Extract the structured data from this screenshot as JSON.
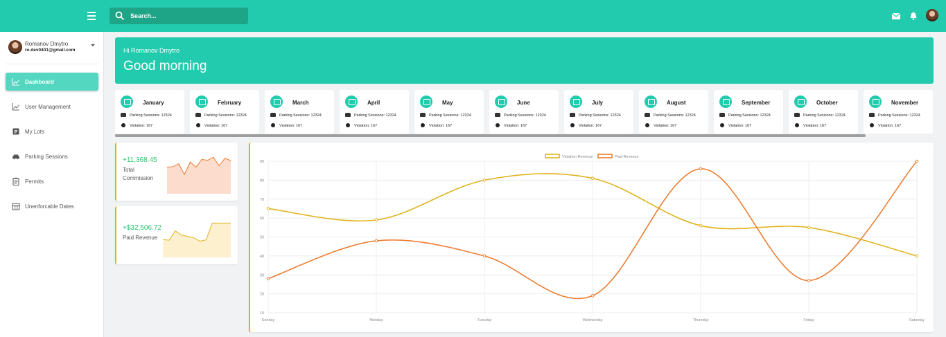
{
  "header": {
    "search_placeholder": "Search...",
    "icons": [
      "menu-icon",
      "search-icon",
      "mail-icon",
      "bell-icon",
      "user-avatar"
    ]
  },
  "user": {
    "name": "Romanov Dmytro",
    "email": "ro.dev0401@gmail.com"
  },
  "sidebar": {
    "items": [
      {
        "label": "Dashboard",
        "icon": "chart-line-icon",
        "active": true
      },
      {
        "label": "User Management",
        "icon": "chart-line-icon",
        "active": false
      },
      {
        "label": "My Lots",
        "icon": "parking-icon",
        "active": false
      },
      {
        "label": "Parking Sessions",
        "icon": "car-icon",
        "active": false
      },
      {
        "label": "Permits",
        "icon": "clipboard-icon",
        "active": false
      },
      {
        "label": "Unenforcable Dates",
        "icon": "calendar-icon",
        "active": false
      }
    ]
  },
  "greeting": {
    "hello": "Hi Romanov Dmytro",
    "message": "Good morning"
  },
  "months": [
    {
      "name": "January",
      "sessions": "Parking Sessions: 12324",
      "violations": "Violation: 167"
    },
    {
      "name": "February",
      "sessions": "Parking Sessions: 12324",
      "violations": "Violation: 167"
    },
    {
      "name": "March",
      "sessions": "Parking Sessions: 12324",
      "violations": "Violation: 167"
    },
    {
      "name": "April",
      "sessions": "Parking Sessions: 12324",
      "violations": "Violation: 167"
    },
    {
      "name": "May",
      "sessions": "Parking Sessions: 12324",
      "violations": "Violation: 167"
    },
    {
      "name": "June",
      "sessions": "Parking Sessions: 12324",
      "violations": "Violation: 167"
    },
    {
      "name": "July",
      "sessions": "Parking Sessions: 12324",
      "violations": "Violation: 167"
    },
    {
      "name": "August",
      "sessions": "Parking Sessions: 12324",
      "violations": "Violation: 167"
    },
    {
      "name": "September",
      "sessions": "Parking Sessions: 12324",
      "violations": "Violation: 167"
    },
    {
      "name": "October",
      "sessions": "Parking Sessions: 12324",
      "violations": "Violation: 167"
    },
    {
      "name": "November",
      "sessions": "Parking Sessions: 12324",
      "violations": "Violation: 167"
    }
  ],
  "stats": {
    "commission": {
      "value": "+11,368.45",
      "label": "Total Commission"
    },
    "paid": {
      "value": "+$32,506.72",
      "label": "Paid Revenue"
    }
  },
  "colors": {
    "primary": "#22cbad",
    "accent_yellow": "#e0b31d",
    "orange": "#ec7c30",
    "green_text": "#33c473"
  },
  "chart_data": [
    {
      "type": "line",
      "categories": [
        "Sunday",
        "Monday",
        "Tuesday",
        "Wednesday",
        "Thursday",
        "Friday",
        "Saturday"
      ],
      "series": [
        {
          "name": "Violation Revenue",
          "color": "#e0b31d",
          "values": [
            65,
            59,
            80,
            81,
            56,
            55,
            40
          ]
        },
        {
          "name": "Paid Revenue",
          "color": "#ec7c30",
          "values": [
            28,
            48,
            40,
            19,
            86,
            27,
            90
          ]
        }
      ],
      "ylim": [
        10,
        90
      ],
      "yticks": [
        10,
        20,
        30,
        40,
        50,
        60,
        70,
        80,
        90
      ],
      "grid": true,
      "legend": "top-center"
    },
    {
      "type": "area",
      "series": [
        {
          "values": [
            62,
            63,
            70,
            45,
            74,
            62,
            80,
            78,
            85,
            65,
            83,
            77
          ]
        }
      ],
      "color": "#ec7c30",
      "fill": "#fcdccc"
    },
    {
      "type": "area",
      "series": [
        {
          "values": [
            42,
            40,
            62,
            52,
            49,
            46,
            38,
            41,
            80,
            80,
            80,
            80
          ]
        }
      ],
      "color": "#e0b31d",
      "fill": "#fdf0cf"
    }
  ]
}
